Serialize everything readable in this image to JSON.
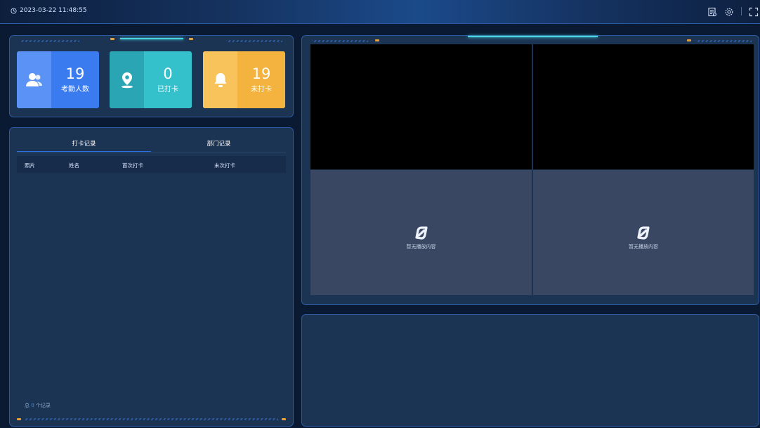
{
  "header": {
    "datetime": "2023-03-22 11:48:55",
    "icons": [
      "report-icon",
      "settings-icon",
      "fullscreen-icon"
    ]
  },
  "stats": [
    {
      "value": "19",
      "label": "考勤人数",
      "icon": "users-icon",
      "color": "#3b7bf0"
    },
    {
      "value": "0",
      "label": "已打卡",
      "icon": "location-icon",
      "color": "#2fb9c6"
    },
    {
      "value": "19",
      "label": "未打卡",
      "icon": "bell-icon",
      "color": "#f1a43a"
    }
  ],
  "records": {
    "tabs": [
      "打卡记录",
      "部门记录"
    ],
    "active_tab": 0,
    "columns": [
      "照片",
      "姓名",
      "首次打卡",
      "末次打卡"
    ],
    "rows": [],
    "footer_prefix": "总",
    "footer_count": "0",
    "footer_suffix": "个记录"
  },
  "video": {
    "empty_text": "暂无播放内容",
    "empty_icon": "no-signal-icon"
  }
}
